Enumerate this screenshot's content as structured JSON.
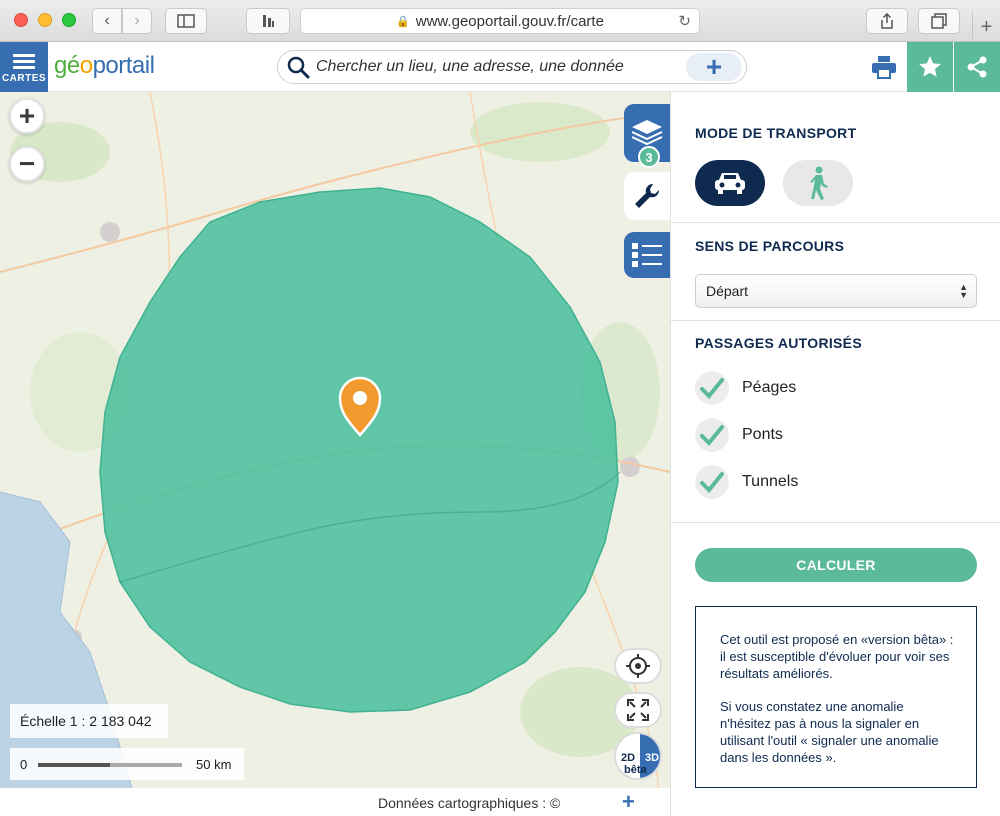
{
  "browser": {
    "url": "www.geoportail.gouv.fr/carte",
    "icons": [
      "back-icon",
      "forward-icon",
      "sidebar-icon",
      "extension-icon",
      "lock-icon",
      "reload-icon",
      "share-icon",
      "tabs-icon",
      "new-tab-icon"
    ]
  },
  "header": {
    "menu_label": "CARTES",
    "logo": {
      "part1": "gé",
      "part2": "o",
      "part3": "portail"
    },
    "search_placeholder": "Chercher un lieu, une adresse, une donnée",
    "search_add": "+"
  },
  "map": {
    "layers_count": "3",
    "zoom_in": "+",
    "zoom_out": "−",
    "mode_2d": "2D",
    "mode_3d": "3D",
    "beta": "bêta",
    "scale_text": "Échelle 1 : 2 183 042",
    "scale_zero": "0",
    "scale_km": "50 km",
    "attribution": "Données cartographiques : ©",
    "attribution_more": "+"
  },
  "panel": {
    "transport_title": "MODE DE TRANSPORT",
    "direction_title": "SENS DE PARCOURS",
    "direction_value": "Départ",
    "passages_title": "PASSAGES AUTORISÉS",
    "passages": [
      {
        "label": "Péages",
        "checked": true
      },
      {
        "label": "Ponts",
        "checked": true
      },
      {
        "label": "Tunnels",
        "checked": true
      }
    ],
    "calculate_label": "CALCULER",
    "info_p1": "Cet outil est proposé en «version bêta» : il est susceptible d'évoluer pour voir ses résultats améliorés.",
    "info_p2": "Si vous constatez une anomalie n'hésitez pas à nous la signaler en utilisant l'outil « signaler une anomalie dans les données »."
  },
  "colors": {
    "brand_blue": "#366eb1",
    "dark_navy": "#0f2a4f",
    "accent_green": "#5bbb98",
    "isochrone_fill": "#4cbf9e",
    "marker_orange": "#f39a2e"
  }
}
